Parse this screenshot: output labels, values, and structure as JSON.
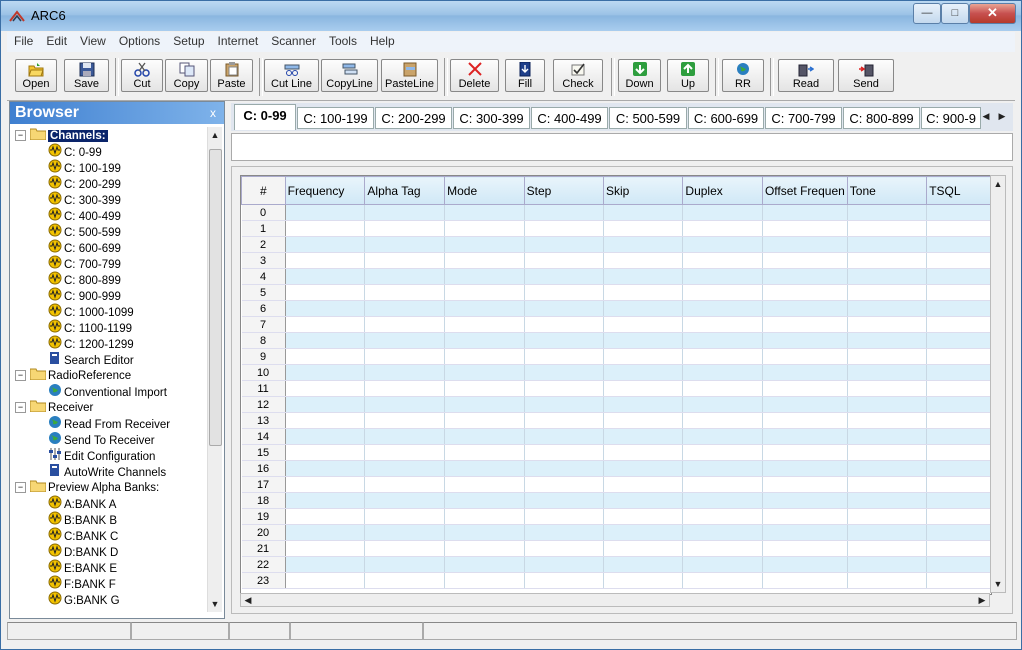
{
  "window": {
    "title": "ARC6"
  },
  "menu": [
    "File",
    "Edit",
    "View",
    "Options",
    "Setup",
    "Internet",
    "Scanner",
    "Tools",
    "Help"
  ],
  "toolbar": {
    "open": "Open",
    "save": "Save",
    "cut": "Cut",
    "copy": "Copy",
    "paste": "Paste",
    "cut_line": "Cut Line",
    "copy_line": "CopyLine",
    "paste_line": "PasteLine",
    "delete": "Delete",
    "fill": "Fill",
    "check": "Check",
    "down": "Down",
    "up": "Up",
    "rr": "RR",
    "read": "Read",
    "send": "Send"
  },
  "browser": {
    "title": "Browser",
    "close": "x",
    "tree": [
      {
        "label": "Channels:",
        "icon": "folder-icon",
        "level": 0,
        "selected": true,
        "expander": "minus"
      },
      {
        "label": "C: 0-99",
        "icon": "channel-icon",
        "level": 1
      },
      {
        "label": "C: 100-199",
        "icon": "channel-icon",
        "level": 1
      },
      {
        "label": "C: 200-299",
        "icon": "channel-icon",
        "level": 1
      },
      {
        "label": "C: 300-399",
        "icon": "channel-icon",
        "level": 1
      },
      {
        "label": "C: 400-499",
        "icon": "channel-icon",
        "level": 1
      },
      {
        "label": "C: 500-599",
        "icon": "channel-icon",
        "level": 1
      },
      {
        "label": "C: 600-699",
        "icon": "channel-icon",
        "level": 1
      },
      {
        "label": "C: 700-799",
        "icon": "channel-icon",
        "level": 1
      },
      {
        "label": "C: 800-899",
        "icon": "channel-icon",
        "level": 1
      },
      {
        "label": "C: 900-999",
        "icon": "channel-icon",
        "level": 1
      },
      {
        "label": "C: 1000-1099",
        "icon": "channel-icon",
        "level": 1
      },
      {
        "label": "C: 1100-1199",
        "icon": "channel-icon",
        "level": 1
      },
      {
        "label": "C: 1200-1299",
        "icon": "channel-icon",
        "level": 1
      },
      {
        "label": "Search Editor",
        "icon": "search-editor-icon",
        "level": 1
      },
      {
        "label": "RadioReference",
        "icon": "folder-icon",
        "level": 0,
        "expander": "minus"
      },
      {
        "label": "Conventional Import",
        "icon": "globe-icon",
        "level": 1
      },
      {
        "label": "Receiver",
        "icon": "folder-icon",
        "level": 0,
        "expander": "minus"
      },
      {
        "label": "Read From Receiver",
        "icon": "globe-icon",
        "level": 1
      },
      {
        "label": "Send To Receiver",
        "icon": "globe-icon",
        "level": 1
      },
      {
        "label": "Edit Configuration",
        "icon": "config-icon",
        "level": 1
      },
      {
        "label": "AutoWrite Channels",
        "icon": "search-editor-icon",
        "level": 1
      },
      {
        "label": "Preview Alpha Banks:",
        "icon": "folder-icon",
        "level": 0,
        "expander": "minus"
      },
      {
        "label": "A:BANK A",
        "icon": "channel-icon",
        "level": 1
      },
      {
        "label": "B:BANK B",
        "icon": "channel-icon",
        "level": 1
      },
      {
        "label": "C:BANK C",
        "icon": "channel-icon",
        "level": 1
      },
      {
        "label": "D:BANK D",
        "icon": "channel-icon",
        "level": 1
      },
      {
        "label": "E:BANK E",
        "icon": "channel-icon",
        "level": 1
      },
      {
        "label": "F:BANK F",
        "icon": "channel-icon",
        "level": 1
      },
      {
        "label": "G:BANK G",
        "icon": "channel-icon",
        "level": 1
      }
    ]
  },
  "tabs": [
    "C: 0-99",
    "C: 100-199",
    "C: 200-299",
    "C: 300-399",
    "C: 400-499",
    "C: 500-599",
    "C: 600-699",
    "C: 700-799",
    "C: 800-899",
    "C: 900-9"
  ],
  "active_tab": 0,
  "grid": {
    "columns": [
      "#",
      "Frequency",
      "Alpha Tag",
      "Mode",
      "Step",
      "Skip",
      "Duplex",
      "Offset Frequen",
      "Tone",
      "TSQL"
    ],
    "rows": [
      "0",
      "1",
      "2",
      "3",
      "4",
      "5",
      "6",
      "7",
      "8",
      "9",
      "10",
      "11",
      "12",
      "13",
      "14",
      "15",
      "16",
      "17",
      "18",
      "19",
      "20",
      "21",
      "22",
      "23"
    ]
  },
  "colors": {
    "selection": "#0a246a",
    "row_alt": "#dcf0fa",
    "browser_header": "#3e7fd0"
  }
}
